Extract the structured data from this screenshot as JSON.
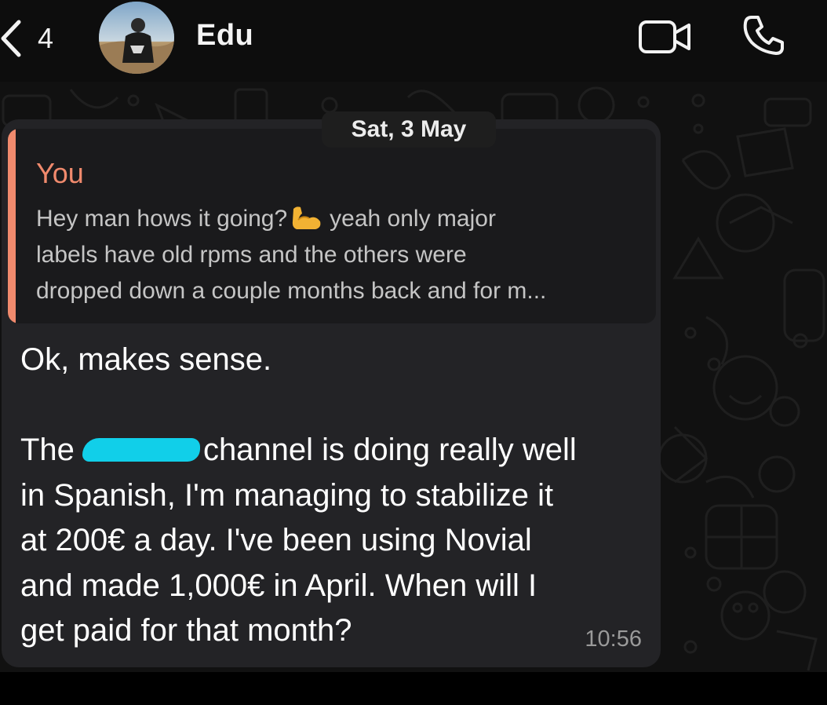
{
  "header": {
    "back_icon": "chevron-left-icon",
    "unread_count": "4",
    "contact_name": "Edu",
    "video_icon": "video-call-icon",
    "call_icon": "phone-icon"
  },
  "chat": {
    "date_label": "Sat, 3 May",
    "message": {
      "quote": {
        "author": "You",
        "lines": [
          "Hey man hows it going?",
          "yeah only major",
          "labels have old rpms and the others were",
          "dropped down a couple months back and for m..."
        ],
        "emoji": "flexed-biceps-emoji"
      },
      "lines": [
        "Ok, makes sense.",
        "",
        "The",
        "channel is doing really well",
        "in Spanish, I'm managing to stabilize it",
        "at 200€ a day. I've been using Novial",
        "and made 1,000€ in April. When will I",
        "get paid for that month?"
      ],
      "time": "10:56"
    }
  },
  "colors": {
    "bubble": "#232326",
    "quote_accent": "#f08a6d",
    "redaction": "#11cfe9",
    "background": "#111111"
  }
}
